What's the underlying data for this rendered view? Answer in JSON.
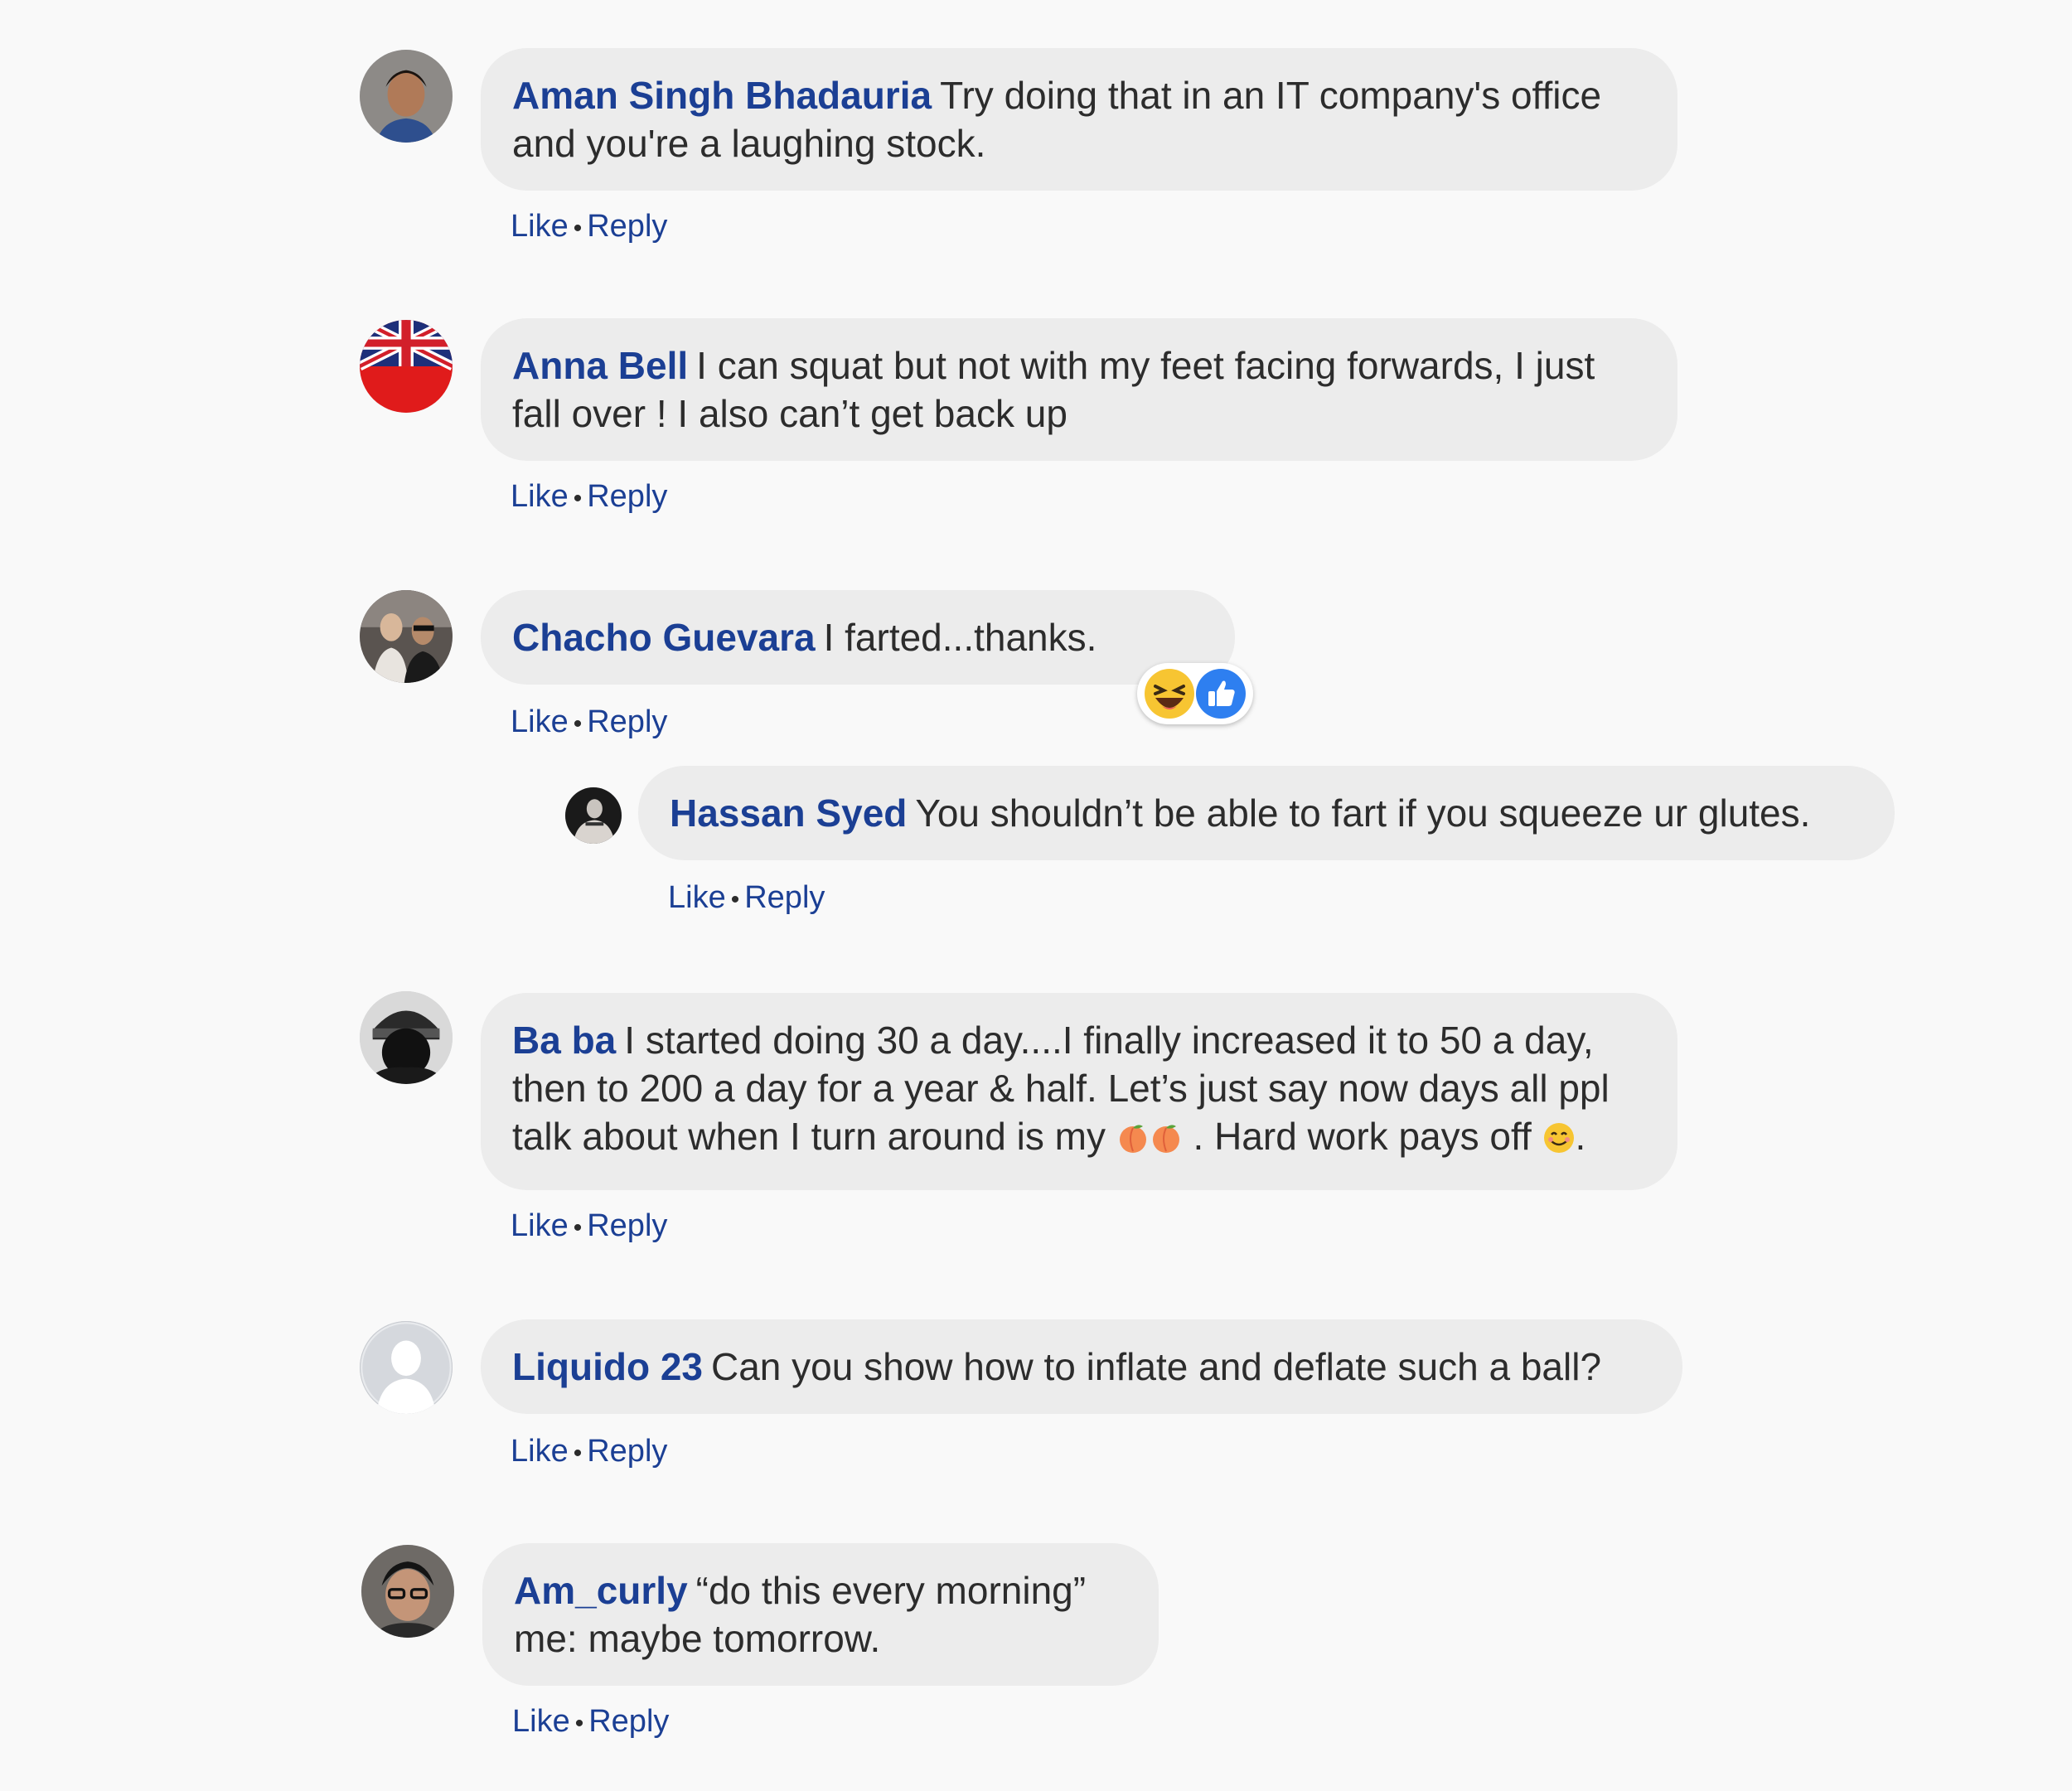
{
  "comments": [
    {
      "author": "Aman Singh Bhadauria",
      "text": "Try doing that in an IT company's office and you're a laughing stock.",
      "like": "Like",
      "reply": "Reply",
      "avatar_icon": "person-photo-icon"
    },
    {
      "author": "Anna Bell",
      "text": "I can squat but not with my feet facing forwards, I just fall over ! I also can’t get back up",
      "like": "Like",
      "reply": "Reply",
      "avatar_icon": "flag-avatar-icon"
    },
    {
      "author": "Chacho Guevara",
      "text": "I farted...thanks.",
      "like": "Like",
      "reply": "Reply",
      "avatar_icon": "group-photo-icon",
      "reactions": [
        "laugh-reaction-icon",
        "like-reaction-icon"
      ]
    },
    {
      "author": "Hassan Syed",
      "text": "You shouldn’t be able to fart if you squeeze ur glutes.",
      "like": "Like",
      "reply": "Reply",
      "avatar_icon": "person-photo-icon"
    },
    {
      "author": "Ba ba",
      "text_part1": "I started doing 30 a day....I finally increased it to 50 a day, then to 200 a day for a year & half. Let’s just say now days all ppl talk about when I turn around is my",
      "text_part2": ". Hard work pays off",
      "text_part3": ".",
      "like": "Like",
      "reply": "Reply",
      "avatar_icon": "person-photo-icon",
      "inline_emojis": [
        "peach-emoji-icon",
        "peach-emoji-icon",
        "smile-emoji-icon"
      ]
    },
    {
      "author": "Liquido 23",
      "text": "Can you show how to inflate and deflate such a ball?",
      "like": "Like",
      "reply": "Reply",
      "avatar_icon": "default-profile-icon"
    },
    {
      "author": "Am_curly",
      "text_line1": "“do this every morning”",
      "text_line2": "me: maybe tomorrow.",
      "like": "Like",
      "reply": "Reply",
      "avatar_icon": "person-photo-icon"
    }
  ],
  "colors": {
    "background": "#f9f9f9",
    "bubble": "#ececec",
    "author": "#1b3f94",
    "text": "#2c2c2c",
    "link": "#1b3f94"
  }
}
